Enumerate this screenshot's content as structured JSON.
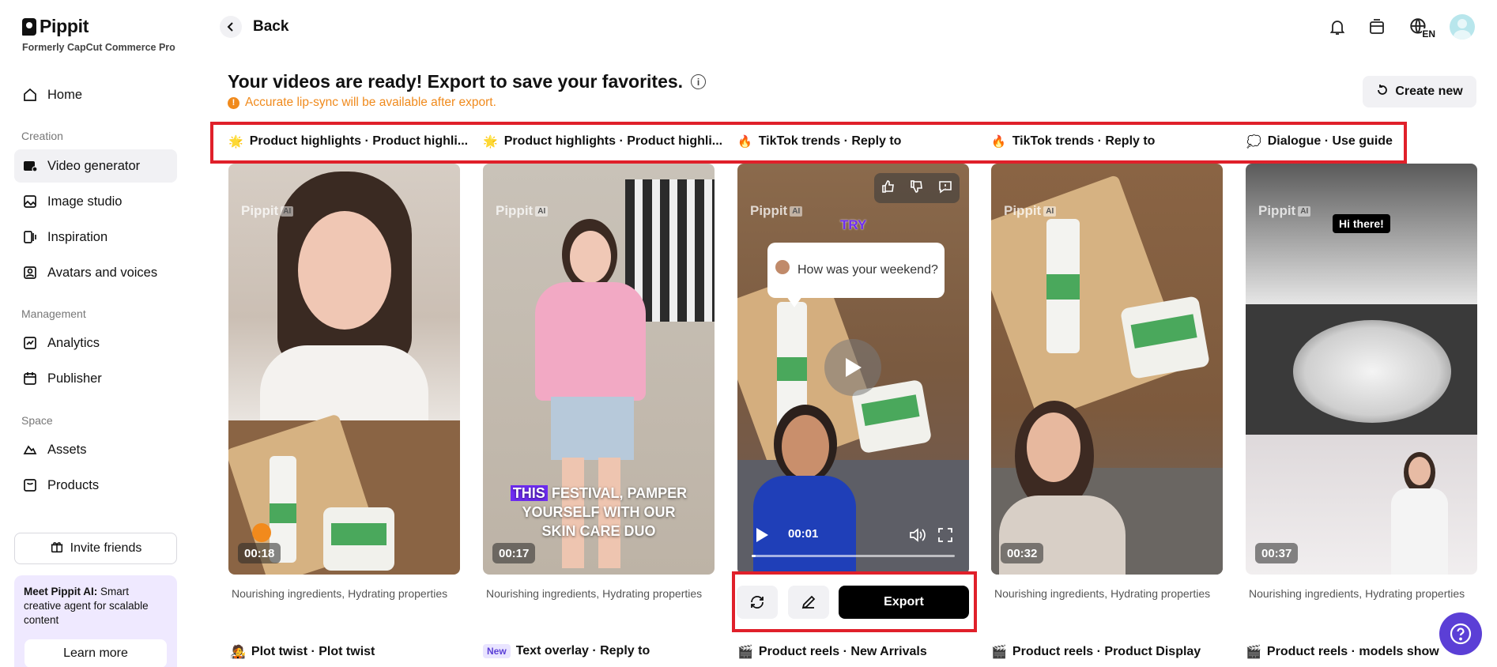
{
  "brand": {
    "name": "Pippit",
    "subtitle": "Formerly CapCut Commerce Pro"
  },
  "sidebar": {
    "home": "Home",
    "section_creation": "Creation",
    "video_generator": "Video generator",
    "image_studio": "Image studio",
    "inspiration": "Inspiration",
    "avatars_voices": "Avatars and voices",
    "section_management": "Management",
    "analytics": "Analytics",
    "publisher": "Publisher",
    "section_space": "Space",
    "assets": "Assets",
    "products": "Products",
    "invite": "Invite friends",
    "promo_bold": "Meet Pippit AI:",
    "promo_rest": " Smart creative agent for scalable content",
    "learn_more": "Learn more"
  },
  "topbar": {
    "back": "Back",
    "lang": "EN"
  },
  "main": {
    "title": "Your videos are ready! Export to save your favorites.",
    "notice": "Accurate lip-sync will be available after export.",
    "create_new": "Create new",
    "watermark": "Pippit",
    "watermark_ai": "AI"
  },
  "categories": [
    {
      "emoji": "🌟",
      "label": "Product highlights · Product highli..."
    },
    {
      "emoji": "🌟",
      "label": "Product highlights · Product highli..."
    },
    {
      "emoji": "🔥",
      "label": "TikTok trends · Reply to"
    },
    {
      "emoji": "🔥",
      "label": "TikTok trends · Reply to"
    },
    {
      "emoji": "💭",
      "label": "Dialogue · Use guide"
    }
  ],
  "cards": [
    {
      "duration": "00:18",
      "desc": "Nourishing ingredients, Hydrating properties"
    },
    {
      "duration": "00:17",
      "desc": "Nourishing ingredients, Hydrating properties",
      "caption_hl": "THIS",
      "caption_rest": " FESTIVAL, PAMPER",
      "caption_line2": "YOURSELF WITH OUR",
      "caption_line3": "SKIN CARE DUO"
    },
    {
      "try": "TRY",
      "bubble": "How was your weekend?",
      "time": "00:01",
      "progress": 0.02
    },
    {
      "duration": "00:32",
      "desc": "Nourishing ingredients, Hydrating properties"
    },
    {
      "duration": "00:37",
      "desc": "Nourishing ingredients, Hydrating properties",
      "tag": "Hi there!"
    }
  ],
  "actions": {
    "export": "Export"
  },
  "bottom_titles": [
    {
      "emoji": "🧑‍🎤",
      "label": "Plot twist · Plot twist"
    },
    {
      "badge": "New",
      "label": "Text overlay · Reply to"
    },
    {
      "emoji": "🎬",
      "label": "Product reels · New Arrivals"
    },
    {
      "emoji": "🎬",
      "label": "Product reels · Product Display"
    },
    {
      "emoji": "🎬",
      "label": "Product reels · models show"
    }
  ],
  "colors": {
    "accent": "#5b3fd6",
    "warning": "#f08a1c",
    "highlight_border": "#e0202a"
  }
}
